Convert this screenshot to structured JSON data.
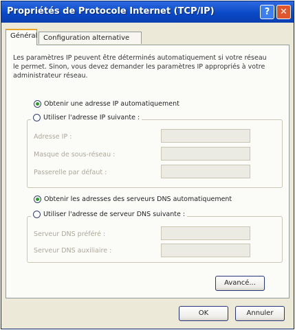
{
  "window": {
    "title": "Propriétés de Protocole Internet (TCP/IP)",
    "help_label": "?",
    "close_label": "✕"
  },
  "tabs": [
    {
      "label": "Général"
    },
    {
      "label": "Configuration alternative"
    }
  ],
  "general": {
    "description": "Les paramètres IP peuvent être déterminés automatiquement si votre réseau le permet. Sinon, vous devez demander les paramètres IP appropriés à votre administrateur réseau.",
    "ip_auto_label": "Obtenir une adresse IP automatiquement",
    "ip_manual_label": "Utiliser l'adresse IP suivante :",
    "ip_address_label": "Adresse IP :",
    "subnet_mask_label": "Masque de sous-réseau :",
    "gateway_label": "Passerelle par défaut :",
    "dns_auto_label": "Obtenir les adresses des serveurs DNS automatiquement",
    "dns_manual_label": "Utiliser l'adresse de serveur DNS suivante :",
    "preferred_dns_label": "Serveur DNS préféré :",
    "alternate_dns_label": "Serveur DNS auxiliaire :",
    "advanced_label": "Avancé..."
  },
  "footer": {
    "ok_label": "OK",
    "cancel_label": "Annuler"
  }
}
